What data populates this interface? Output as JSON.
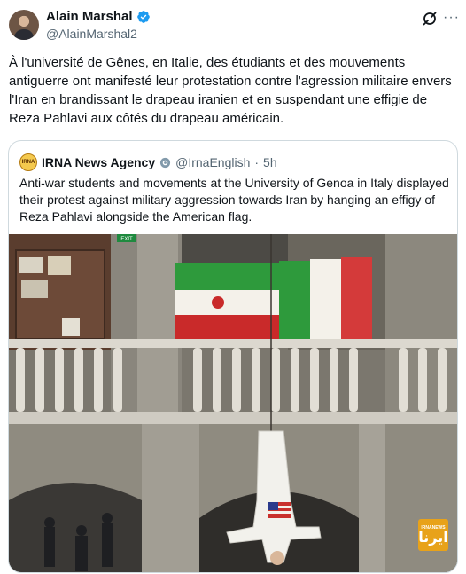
{
  "post": {
    "author_name": "Alain Marshal",
    "author_handle": "@AlainMarshal2",
    "text": "À l'université de Gênes, en Italie, des étudiants et des mouvements antiguerre ont manifesté leur protestation contre l'agression militaire envers l'Iran en brandissant le drapeau iranien et en suspendant une effigie de Reza Pahlavi aux côtés du drapeau américain.",
    "verified": true
  },
  "quoted": {
    "author_name": "IRNA News Agency",
    "author_handle": "@IrnaEnglish",
    "separator": "·",
    "time": "5h",
    "text": "Anti-war students and movements at the University of Genoa in Italy displayed their protest against military aggression towards Iran by hanging an effigy of Reza Pahlavi alongside the American flag.",
    "avatar_text": "IRNA"
  },
  "photo": {
    "watermark_small": "IRNANEWS",
    "watermark_big": "ایرنا",
    "exit_sign": "EXIT"
  },
  "icons": {
    "verified": "verified-badge-icon",
    "grok": "grok-icon",
    "more": "more-icon",
    "gov_badge": "government-badge-icon"
  },
  "colors": {
    "verified_blue": "#1d9bf0",
    "muted": "#536471",
    "border": "#cfd9de"
  }
}
